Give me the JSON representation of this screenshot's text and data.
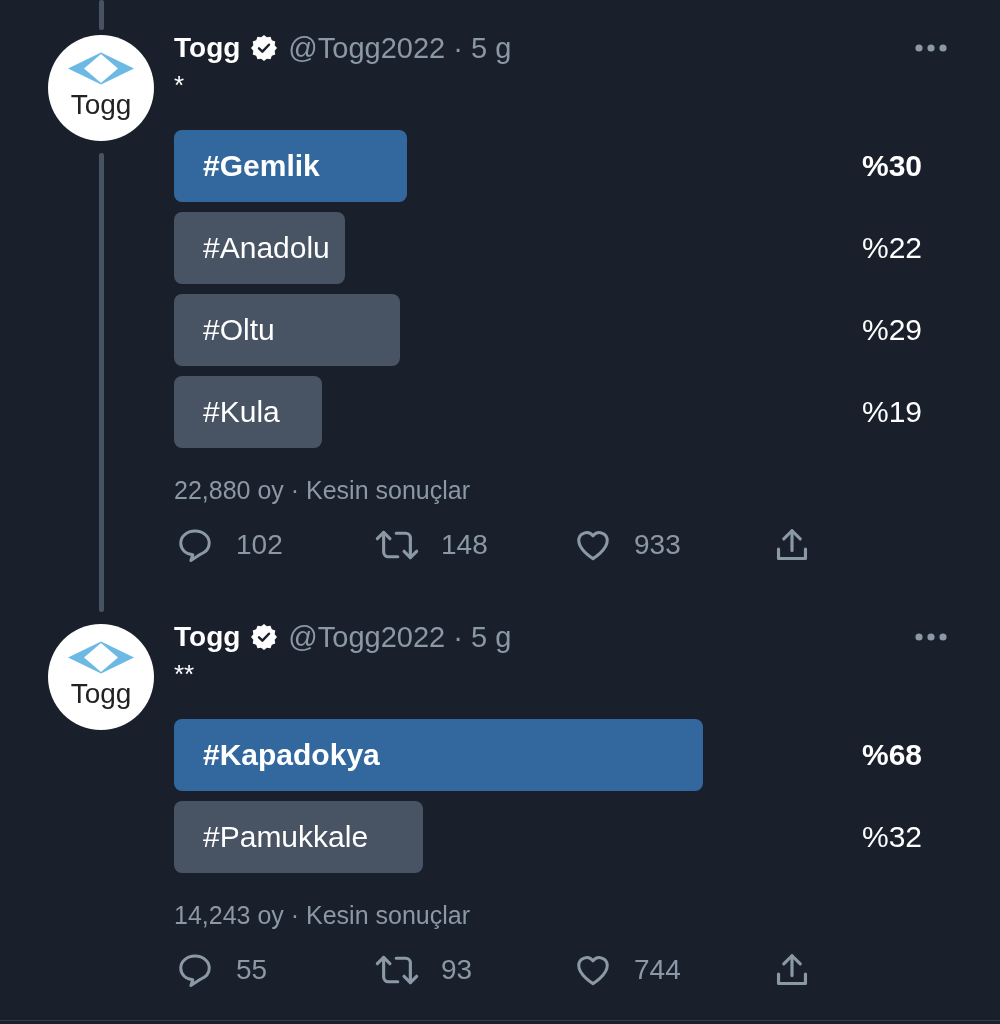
{
  "tweets": [
    {
      "connected_above": true,
      "connected_below": true,
      "author": {
        "avatar_text": "Togg",
        "name": "Togg",
        "verified": true,
        "meta": "@Togg2022 · 5 g"
      },
      "text": "*",
      "poll": {
        "options": [
          {
            "label": "#Gemlik",
            "percent": "%30",
            "level": 0.3,
            "winner": true
          },
          {
            "label": "#Anadolu",
            "percent": "%22",
            "level": 0.22,
            "winner": false
          },
          {
            "label": "#Oltu",
            "percent": "%29",
            "level": 0.29,
            "winner": false
          },
          {
            "label": "#Kula",
            "percent": "%19",
            "level": 0.19,
            "winner": false
          }
        ],
        "summary": "22,880 oy · Kesin sonuçlar"
      },
      "actions": [
        {
          "kind": "reply",
          "count": "102"
        },
        {
          "kind": "retweet",
          "count": "148"
        },
        {
          "kind": "like",
          "count": "933"
        },
        {
          "kind": "share"
        }
      ]
    },
    {
      "connected_above": false,
      "connected_below": false,
      "author": {
        "avatar_text": "Togg",
        "name": "Togg",
        "verified": true,
        "meta": "@Togg2022 · 5 g"
      },
      "text": "**",
      "poll": {
        "options": [
          {
            "label": "#Kapadokya",
            "percent": "%68",
            "level": 0.68,
            "winner": true
          },
          {
            "label": "#Pamukkale",
            "percent": "%32",
            "level": 0.32,
            "winner": false
          }
        ],
        "summary": "14,243 oy · Kesin sonuçlar"
      },
      "actions": [
        {
          "kind": "reply",
          "count": "55"
        },
        {
          "kind": "retweet",
          "count": "93"
        },
        {
          "kind": "like",
          "count": "744"
        },
        {
          "kind": "share"
        }
      ]
    }
  ]
}
